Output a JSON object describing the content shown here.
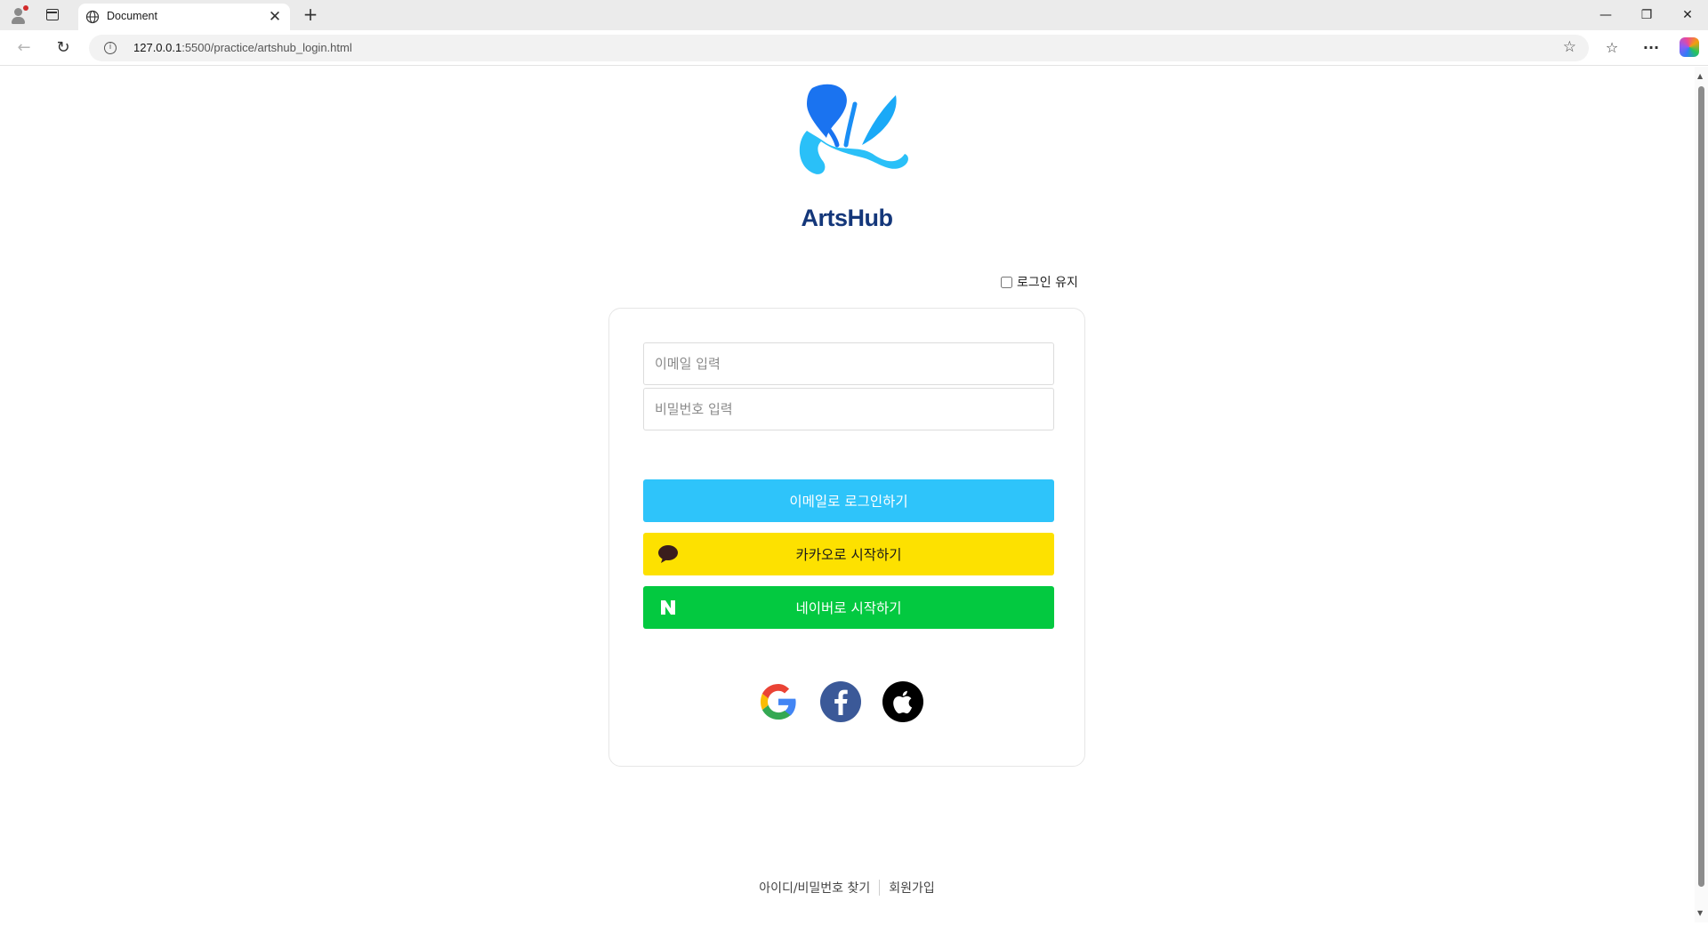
{
  "browser": {
    "tab_title": "Document",
    "tab_close": "✕",
    "new_tab": "+",
    "url_host": "127.0.0.1",
    "url_path": ":5500/practice/artshub_login.html",
    "window_controls": {
      "minimize": "—",
      "restore": "❐",
      "close": "✕"
    },
    "nav": {
      "back": "←",
      "refresh": "↻"
    },
    "toolbar_icons": {
      "favorites": "☆",
      "collections": "☆",
      "more": "···"
    }
  },
  "page": {
    "logo_text": "ArtsHub",
    "keep_login": {
      "label": "로그인 유지",
      "checked": false
    },
    "email": {
      "placeholder": "이메일 입력",
      "value": ""
    },
    "password": {
      "placeholder": "비밀번호 입력",
      "value": ""
    },
    "email_login_label": "이메일로 로그인하기",
    "kakao_label": "카카오로 시작하기",
    "naver_label": "네이버로 시작하기",
    "naver_icon_letter": "N",
    "social": [
      "google-icon",
      "facebook-icon",
      "apple-icon"
    ],
    "footer": {
      "find_account": "아이디/비밀번호 찾기",
      "signup": "회원가입"
    }
  },
  "colors": {
    "email_button": "#2ec4fa",
    "kakao_button": "#fde100",
    "naver_button": "#03c940",
    "logo_text": "#14377a",
    "facebook": "#3b5998"
  }
}
